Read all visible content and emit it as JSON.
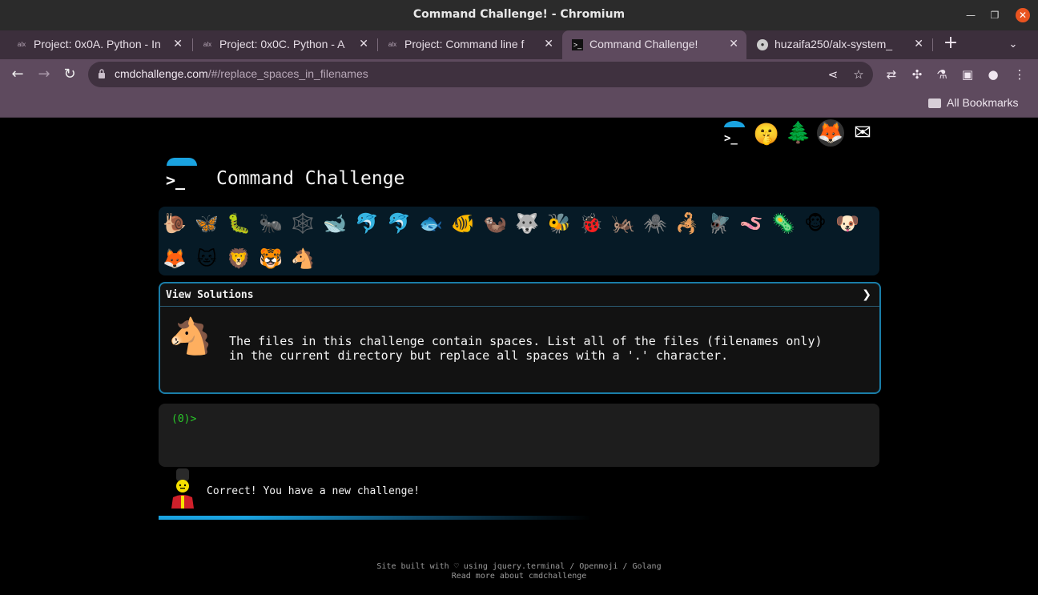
{
  "window": {
    "title": "Command Challenge! - Chromium"
  },
  "tabs": [
    {
      "label": "Project: 0x0A. Python - In",
      "favicon": "alx-favicon",
      "active": false
    },
    {
      "label": "Project: 0x0C. Python - A",
      "favicon": "alx-favicon",
      "active": false
    },
    {
      "label": "Project: Command line f",
      "favicon": "alx-favicon",
      "active": false
    },
    {
      "label": "Command Challenge!",
      "favicon": "terminal-favicon",
      "active": true
    },
    {
      "label": "huzaifa250/alx-system_",
      "favicon": "github-favicon",
      "active": false
    }
  ],
  "toolbar": {
    "url_host": "cmdchallenge.com",
    "url_path": "/#/replace_spaces_in_filenames"
  },
  "bookmarks": {
    "label": "All Bookmarks"
  },
  "page": {
    "title": "Command Challenge",
    "logo_prompt": ">_",
    "emojis_row1": [
      "🐌",
      "🦋",
      "🐛",
      "🐜",
      "🕸️",
      "🐋",
      "🐬",
      "🐬",
      "🐟",
      "🐠",
      "🦦",
      "🐺",
      "🐝",
      "🐞",
      "🦗",
      "🕷️",
      "🦂",
      "🪰",
      "🪱",
      "🦠",
      "🐵",
      "🐶"
    ],
    "emojis_row2": [
      "🦊",
      "🐱",
      "🦁",
      "🐯",
      "🐴"
    ],
    "solutions_label": "View Solutions",
    "solutions_chevron": "❯",
    "challenge_line1": "The files in this challenge contain spaces. List all of the files (filenames only)",
    "challenge_line2": "in the current directory but replace all spaces with a '.' character.",
    "terminal_prompt": "(0)>",
    "feedback": "Correct! You have a new challenge!",
    "progress_fraction": 0.6,
    "footer_line1": "Site built with ♡ using jquery.terminal / Openmoji / Golang",
    "footer_line2": "Read more about cmdchallenge"
  },
  "colors": {
    "accent": "#1aa3e0",
    "prompt_green": "#29c929",
    "chrome_purple": "#5e4a5e"
  }
}
